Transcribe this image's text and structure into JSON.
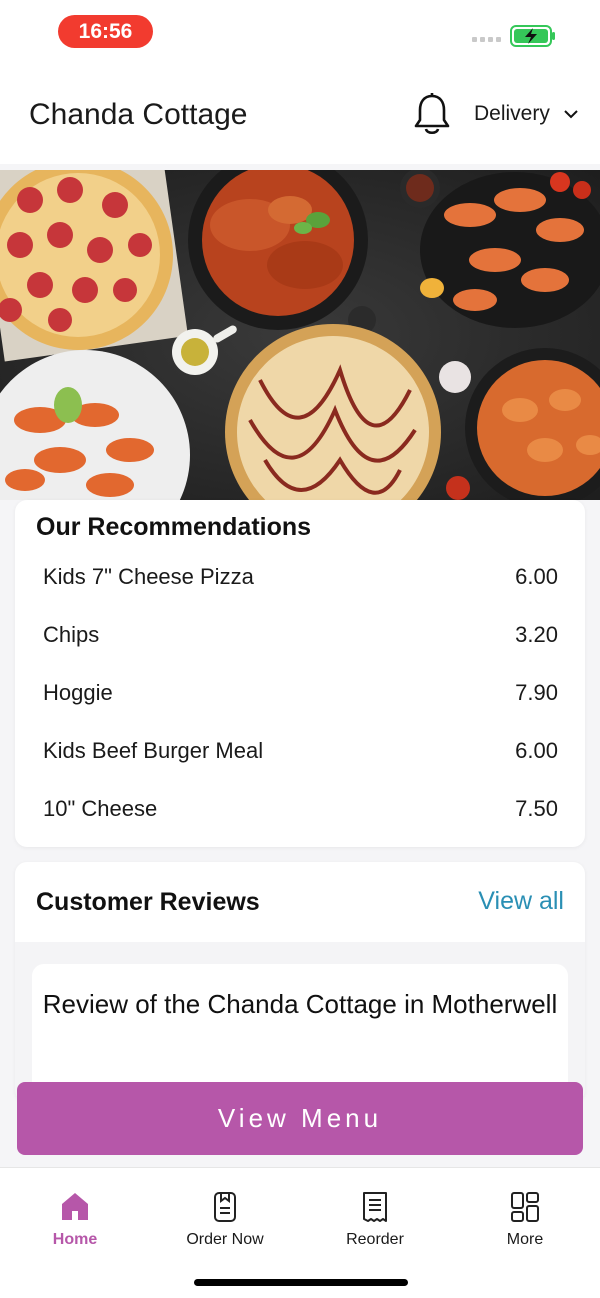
{
  "status_bar": {
    "time": "16:56"
  },
  "header": {
    "title": "Chanda Cottage",
    "delivery_label": "Delivery"
  },
  "recommendations": {
    "title": "Our Recommendations",
    "items": [
      {
        "name": "Kids 7\" Cheese Pizza",
        "price": "6.00"
      },
      {
        "name": "Chips",
        "price": "3.20"
      },
      {
        "name": "Hoggie",
        "price": "7.90"
      },
      {
        "name": "Kids Beef Burger Meal",
        "price": "6.00"
      },
      {
        "name": "10\" Cheese",
        "price": "7.50"
      }
    ]
  },
  "reviews": {
    "title": "Customer Reviews",
    "view_all": "View all",
    "review_heading": "Review of the Chanda Cottage in Motherwell"
  },
  "view_menu_label": "View Menu",
  "tabs": [
    {
      "label": "Home",
      "icon": "home-icon",
      "active": true
    },
    {
      "label": "Order Now",
      "icon": "order-now-icon",
      "active": false
    },
    {
      "label": "Reorder",
      "icon": "receipt-icon",
      "active": false
    },
    {
      "label": "More",
      "icon": "grid-icon",
      "active": false
    }
  ],
  "colors": {
    "accent": "#b657a9",
    "link": "#2a8fb4",
    "time_pill": "#f23b2f",
    "battery": "#35c759"
  }
}
